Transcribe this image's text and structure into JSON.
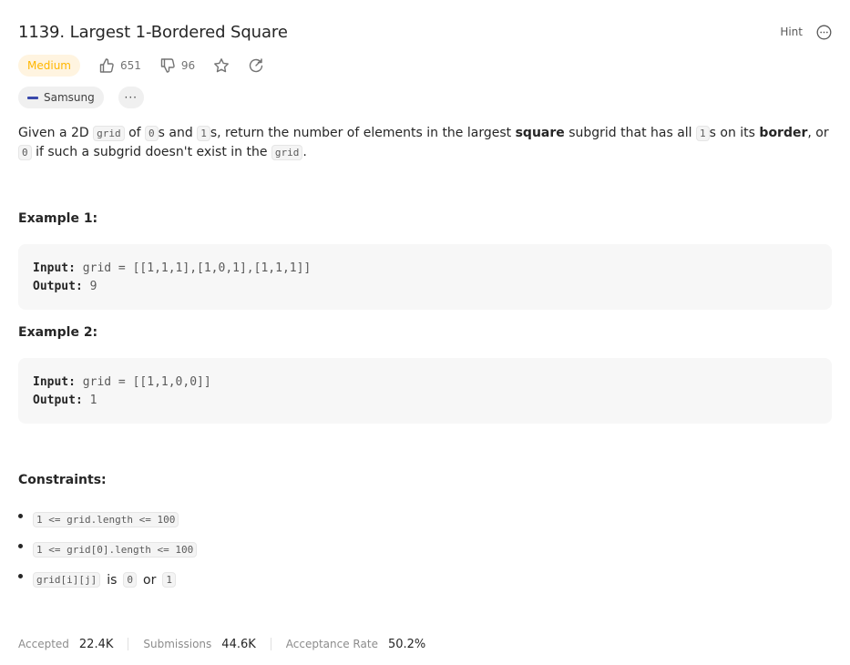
{
  "problem": {
    "title": "1139. Largest 1-Bordered Square",
    "hint_label": "Hint",
    "difficulty": "Medium",
    "likes": "651",
    "dislikes": "96",
    "company_tag": "Samsung",
    "more_tags": "···"
  },
  "description": {
    "p1": "Given a 2D ",
    "code_grid": "grid",
    "p2": " of ",
    "code_0": "0",
    "p3": "s and ",
    "code_1": "1",
    "p4": "s, return the number of elements in the largest ",
    "bold_square": "square",
    "p5": " subgrid that has all ",
    "code_1b": "1",
    "p6": "s on its ",
    "bold_border": "border",
    "p7": ", or ",
    "code_0b": "0",
    "p8": " if such a subgrid doesn't exist in the ",
    "code_grid2": "grid",
    "p9": "."
  },
  "examples": [
    {
      "heading": "Example 1:",
      "input_label": "Input:",
      "input": "grid = [[1,1,1],[1,0,1],[1,1,1]]",
      "output_label": "Output:",
      "output": "9"
    },
    {
      "heading": "Example 2:",
      "input_label": "Input:",
      "input": "grid = [[1,1,0,0]]",
      "output_label": "Output:",
      "output": "1"
    }
  ],
  "constraints": {
    "heading": "Constraints:",
    "c1": "1 <= grid.length <= 100",
    "c2": "1 <= grid[0].length <= 100",
    "c3_code": "grid[i][j]",
    "c3_is": "is",
    "c3_code0": "0",
    "c3_or": "or",
    "c3_code1": "1"
  },
  "stats": {
    "accepted_label": "Accepted",
    "accepted_value": "22.4K",
    "submissions_label": "Submissions",
    "submissions_value": "44.6K",
    "rate_label": "Acceptance Rate",
    "rate_value": "50.2%"
  },
  "colors": {
    "difficulty_text": "#ffb700",
    "difficulty_bg": "#fff4e0",
    "company_logo": "#3949ab"
  },
  "icons": [
    "more-icon",
    "thumbs-up-icon",
    "thumbs-down-icon",
    "star-icon",
    "share-icon",
    "samsung-logo-icon"
  ]
}
